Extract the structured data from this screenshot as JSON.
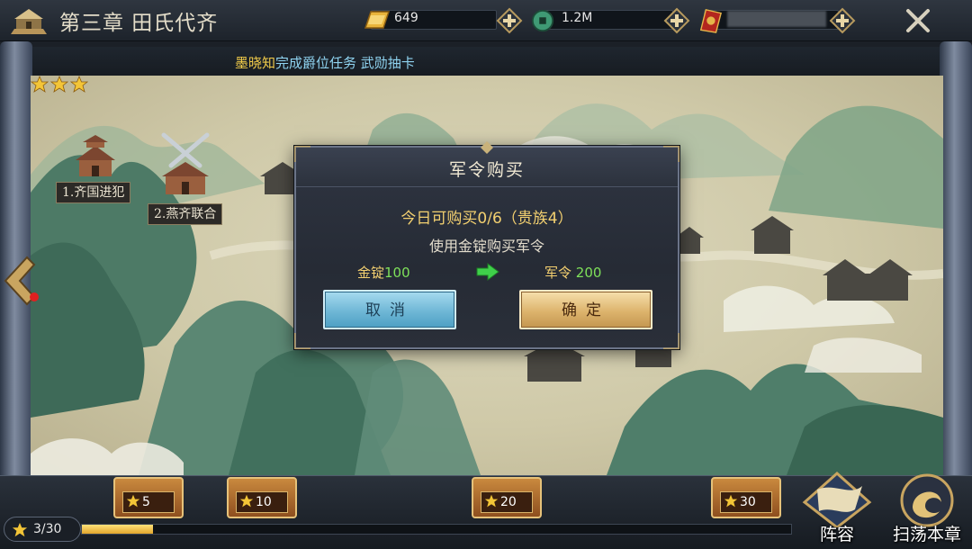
{
  "header": {
    "chapter_title": "第三章  田氏代齐",
    "resources": [
      {
        "name": "gold-ingot",
        "value": "649"
      },
      {
        "name": "copper-coin",
        "value": "1.2M"
      },
      {
        "name": "military-order",
        "value": ""
      }
    ]
  },
  "ticker": {
    "player_name": "墨晓知",
    "message": "完成爵位任务  武勋抽卡"
  },
  "map": {
    "stages": [
      {
        "label": "1.齐国进犯",
        "stars": 3
      },
      {
        "label": "2.燕齐联合"
      }
    ]
  },
  "dialog": {
    "title": "军令购买",
    "purchase_info": "今日可购买0/6（贵族4）",
    "description": "使用金锭购买军令",
    "cost_label": "金锭",
    "cost_value": "100",
    "gain_label": "军令",
    "gain_value": " 200",
    "cancel_label": "取消",
    "confirm_label": "确定"
  },
  "footer": {
    "star_progress_text": "3/30",
    "star_progress_fraction": 0.1,
    "chests": [
      {
        "threshold": "5"
      },
      {
        "threshold": "10"
      },
      {
        "threshold": "20"
      },
      {
        "threshold": "30"
      }
    ],
    "lineup_label": "阵容",
    "sweep_label": "扫荡本章"
  },
  "colors": {
    "gold_text": "#f3d070",
    "green_value": "#7ee05a",
    "ticker_blue": "#8fd3f0",
    "cancel_button": "#6fb7d6",
    "confirm_button": "#ddb46d"
  }
}
